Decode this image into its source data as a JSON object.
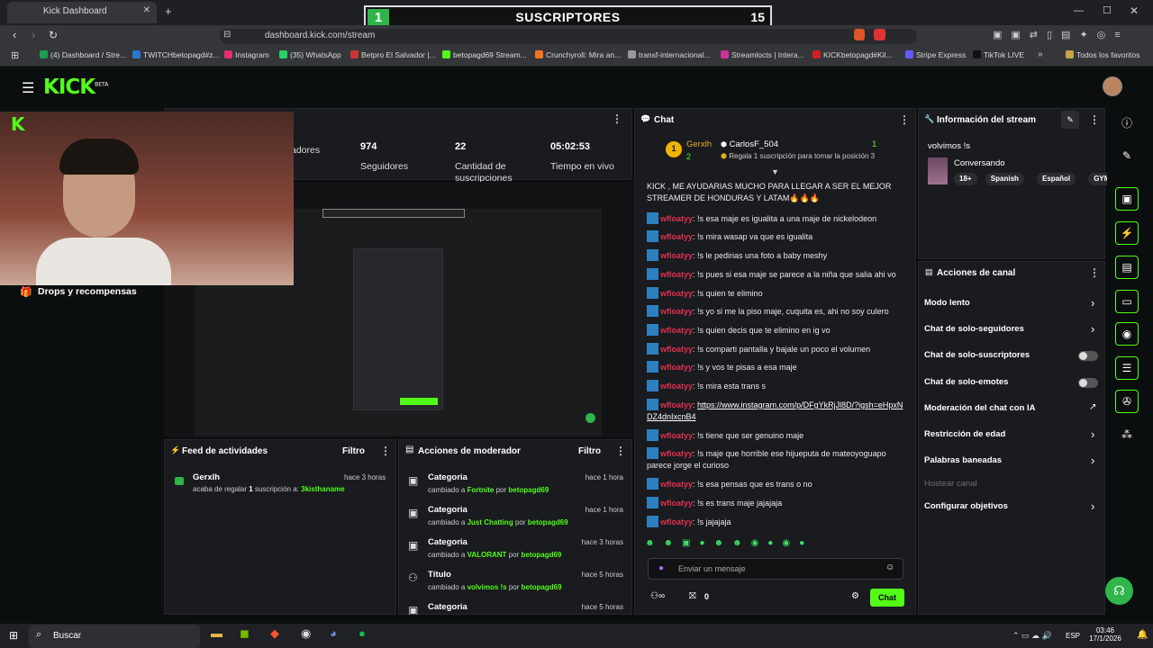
{
  "browser": {
    "tab_title": "Kick Dashboard",
    "url": "dashboard.kick.com/stream",
    "bookmarks": [
      "(4) Dashboard / Stre...",
      "TWITCHbetopagd#z...",
      "Instagram",
      "(35) WhatsApp",
      "Betpro El Salvador |...",
      "betopagd69 Stream...",
      "Crunchyroll: Mira an...",
      "transf-internacional...",
      "Streamlocts | Intera...",
      "KICKbetopagd#Kil...",
      "Stripe Express",
      "TikTok LIVE",
      "Todos los favoritos"
    ],
    "bookmark_colors": [
      "#1a9e50",
      "#2977cc",
      "#e1306c",
      "#25d366",
      "#cc3333",
      "#53fc18",
      "#f47521",
      "#999999",
      "#cc3399",
      "#cc2222",
      "#635bff",
      "#111111",
      "#c8a14a"
    ]
  },
  "overlay": {
    "sub_count_left": "1",
    "title": "SUSCRIPTORES",
    "sub_count_right": "15"
  },
  "kick": {
    "logo": "KICK",
    "beta": "BETA"
  },
  "stats": {
    "followers_value": "974",
    "followers_label": "Seguidores",
    "subs_value": "22",
    "subs_label": "Cantidad de suscripciones",
    "time_value": "05:02:53",
    "time_label": "Tiempo en vivo",
    "viewers_label": "adores"
  },
  "sidebar": {
    "drops": "Drops y recompensas"
  },
  "activity": {
    "title": "Feed de actividades",
    "filter": "Filtro",
    "items": [
      {
        "user": "Gerxlh",
        "time": "hace 3 horas",
        "prefix": "acaba de regalar",
        "count": "1",
        "middle": "suscripción a:",
        "target": "3kisthaname"
      }
    ]
  },
  "mod_actions": {
    "title": "Acciones de moderador",
    "filter": "Filtro",
    "items": [
      {
        "title": "Categoria",
        "time": "hace 1 hora",
        "changed": "cambiado a",
        "value": "Fortnite",
        "by": "por",
        "user": "betopagd69"
      },
      {
        "title": "Categoria",
        "time": "hace 1 hora",
        "changed": "cambiado a",
        "value": "Just Chatting",
        "by": "por",
        "user": "betopagd69"
      },
      {
        "title": "Categoria",
        "time": "hace 3 horas",
        "changed": "cambiado a",
        "value": "VALORANT",
        "by": "por",
        "user": "betopagd69"
      },
      {
        "title": "Título",
        "time": "hace 5 horas",
        "changed": "cambiado a",
        "value": "volvimos !s",
        "by": "por",
        "user": "betopagd69"
      },
      {
        "title": "Categoria",
        "time": "hace 5 horas",
        "changed": "",
        "value": "",
        "by": "",
        "user": ""
      }
    ]
  },
  "chat": {
    "title": "Chat",
    "pinned_rank": "1",
    "pinned_user": "Gerxlh",
    "pinned_user_count": "2",
    "pinned_gifter": "CarlosF_504",
    "pinned_gifter_count": "1",
    "pinned_desc": "Regala 1 suscripción para tomar la posición 3",
    "top_message": "KICK , ME AYUDARIAS MUCHO PARA LLEGAR A SER EL MEJOR STREAMER DE HONDURAS Y LATAM🔥🔥🔥",
    "messages": [
      {
        "user": "wfloatyy",
        "text": "!s esa maje es igualita a una maje de nickelodeon"
      },
      {
        "user": "wfloatyy",
        "text": "!s mira wasap va que es igualita"
      },
      {
        "user": "wfloatyy",
        "text": "!s le pedirias una foto a baby meshy"
      },
      {
        "user": "wfloatyy",
        "text": "!s pues si esa maje se parece a la niña que salia ahi vo"
      },
      {
        "user": "wfloatyy",
        "text": "!s quien te elimino"
      },
      {
        "user": "wfloatyy",
        "text": "!s yo si me la piso maje, cuquita es, ahi no soy culero"
      },
      {
        "user": "wfloatyy",
        "text": "!s quien decis que te elimino en ig vo"
      },
      {
        "user": "wfloatyy",
        "text": "!s comparti pantalla y bajale un poco el volumen"
      },
      {
        "user": "wfloatyy",
        "text": "!s y vos te pisas a esa maje"
      },
      {
        "user": "wfloatyy",
        "text": "!s mira esta trans s"
      },
      {
        "user": "wfloatyy",
        "text": "https://www.instagram.com/p/DFgYkRjJl8D/?igsh=eHpxNDZ4dnIxcnB4"
      },
      {
        "user": "wfloatyy",
        "text": "!s tiene que ser genuino maje"
      },
      {
        "user": "wfloatyy",
        "text": "!s maje que horrible ese hijueputa de mateoyoguapo parece jorge el curioso"
      },
      {
        "user": "wfloatyy",
        "text": "!s esa pensas que es trans o no"
      },
      {
        "user": "wfloatyy",
        "text": "!s es trans maje jajajaja"
      },
      {
        "user": "wfloatyy",
        "text": "!s jajajaja"
      }
    ],
    "input_placeholder": "Enviar un mensaje",
    "footer_count": "0",
    "send": "Chat"
  },
  "stream_info": {
    "title": "Información del stream",
    "stream_title": "volvimos !s",
    "category": "Conversando",
    "tags": [
      "18+",
      "Spanish",
      "Español",
      "GYM"
    ]
  },
  "channel_actions": {
    "title": "Acciones de canal",
    "items": [
      {
        "label": "Modo lento",
        "kind": "chevron"
      },
      {
        "label": "Chat de solo-seguidores",
        "kind": "chevron"
      },
      {
        "label": "Chat de solo-suscriptores",
        "kind": "toggle"
      },
      {
        "label": "Chat de solo-emotes",
        "kind": "toggle"
      },
      {
        "label": "Moderación del chat con IA",
        "kind": "external"
      },
      {
        "label": "Restricción de edad",
        "kind": "chevron"
      },
      {
        "label": "Palabras baneadas",
        "kind": "chevron"
      },
      {
        "label": "Hostear canal",
        "kind": "disabled"
      },
      {
        "label": "Configurar objetivos",
        "kind": "chevron"
      }
    ]
  },
  "taskbar": {
    "search": "Buscar",
    "lang": "ESP",
    "time": "03:46",
    "date": "17/1/2026"
  },
  "colors": {
    "accent": "#53fc18",
    "panel": "#191b1f",
    "bg": "#0b0e0f",
    "chat_user": "#e0314e"
  }
}
